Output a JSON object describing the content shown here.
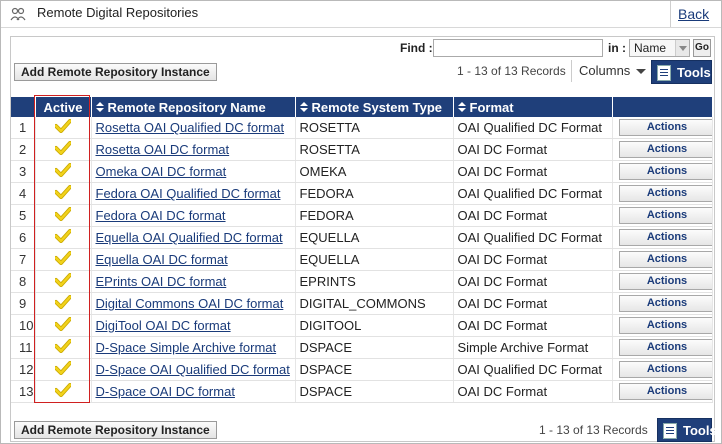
{
  "page": {
    "title": "Remote Digital Repositories",
    "back_label": "Back"
  },
  "toolbar": {
    "find_label": "Find :",
    "find_value": "",
    "in_label": "in :",
    "in_value": "Name",
    "go_label": "Go",
    "add_label": "Add Remote Repository Instance",
    "records_label": "1 - 13 of 13 Records",
    "columns_label": "Columns",
    "tools_label": "Tools"
  },
  "table": {
    "headers": {
      "active": "Active",
      "name": "Remote Repository Name",
      "type": "Remote System Type",
      "format": "Format"
    },
    "action_label": "Actions",
    "rows": [
      {
        "num": "1",
        "name": "Rosetta OAI Qualified DC format",
        "type": "ROSETTA",
        "format": "OAI Qualified DC Format"
      },
      {
        "num": "2",
        "name": "Rosetta OAI DC format",
        "type": "ROSETTA",
        "format": "OAI DC Format"
      },
      {
        "num": "3",
        "name": "Omeka OAI DC format",
        "type": "OMEKA",
        "format": "OAI DC Format"
      },
      {
        "num": "4",
        "name": "Fedora OAI Qualified DC format",
        "type": "FEDORA",
        "format": "OAI Qualified DC Format"
      },
      {
        "num": "5",
        "name": "Fedora OAI DC format",
        "type": "FEDORA",
        "format": "OAI DC Format"
      },
      {
        "num": "6",
        "name": "Equella OAI Qualified DC format",
        "type": "EQUELLA",
        "format": "OAI Qualified DC Format"
      },
      {
        "num": "7",
        "name": "Equella OAI DC format",
        "type": "EQUELLA",
        "format": "OAI DC Format"
      },
      {
        "num": "8",
        "name": "EPrints OAI DC format",
        "type": "EPRINTS",
        "format": "OAI DC Format"
      },
      {
        "num": "9",
        "name": "Digital Commons OAI DC format",
        "type": "DIGITAL_COMMONS",
        "format": "OAI DC Format"
      },
      {
        "num": "10",
        "name": "DigiTool OAI DC format",
        "type": "DIGITOOL",
        "format": "OAI DC Format"
      },
      {
        "num": "11",
        "name": "D-Space Simple Archive format",
        "type": "DSPACE",
        "format": "Simple Archive Format"
      },
      {
        "num": "12",
        "name": "D-Space OAI Qualified DC format",
        "type": "DSPACE",
        "format": "OAI Qualified DC Format"
      },
      {
        "num": "13",
        "name": "D-Space OAI DC format",
        "type": "DSPACE",
        "format": "OAI DC Format"
      }
    ]
  },
  "colors": {
    "header_bg": "#1f3f7a",
    "link": "#1a3b7a",
    "check": "#f2d21b",
    "highlight": "#d02020"
  }
}
